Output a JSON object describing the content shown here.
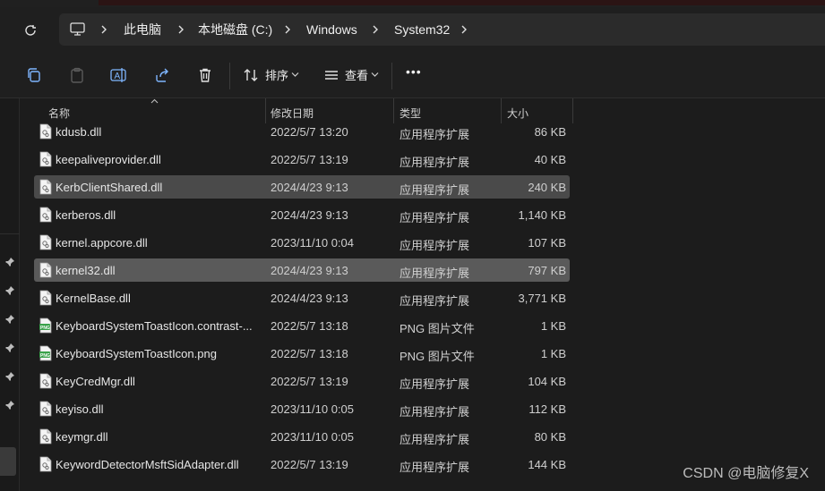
{
  "address": {
    "refresh_icon": "refresh-icon",
    "computer_icon": "computer-icon",
    "crumbs": [
      "此电脑",
      "本地磁盘 (C:)",
      "Windows",
      "System32"
    ]
  },
  "toolbar": {
    "sort_label": "排序",
    "view_label": "查看",
    "more_label": "•••"
  },
  "columns": {
    "name": "名称",
    "date": "修改日期",
    "type": "类型",
    "size": "大小"
  },
  "files": [
    {
      "name": "kdusb.dll",
      "date": "2022/5/7 13:20",
      "type": "应用程序扩展",
      "size": "86 KB",
      "icon": "dll"
    },
    {
      "name": "keepaliveprovider.dll",
      "date": "2022/5/7 13:19",
      "type": "应用程序扩展",
      "size": "40 KB",
      "icon": "dll"
    },
    {
      "name": "KerbClientShared.dll",
      "date": "2024/4/23 9:13",
      "type": "应用程序扩展",
      "size": "240 KB",
      "icon": "dll",
      "selected": true
    },
    {
      "name": "kerberos.dll",
      "date": "2024/4/23 9:13",
      "type": "应用程序扩展",
      "size": "1,140 KB",
      "icon": "dll"
    },
    {
      "name": "kernel.appcore.dll",
      "date": "2023/11/10 0:04",
      "type": "应用程序扩展",
      "size": "107 KB",
      "icon": "dll"
    },
    {
      "name": "kernel32.dll",
      "date": "2024/4/23 9:13",
      "type": "应用程序扩展",
      "size": "797 KB",
      "icon": "dll",
      "selected": true
    },
    {
      "name": "KernelBase.dll",
      "date": "2024/4/23 9:13",
      "type": "应用程序扩展",
      "size": "3,771 KB",
      "icon": "dll"
    },
    {
      "name": "KeyboardSystemToastIcon.contrast-...",
      "date": "2022/5/7 13:18",
      "type": "PNG 图片文件",
      "size": "1 KB",
      "icon": "png"
    },
    {
      "name": "KeyboardSystemToastIcon.png",
      "date": "2022/5/7 13:18",
      "type": "PNG 图片文件",
      "size": "1 KB",
      "icon": "png"
    },
    {
      "name": "KeyCredMgr.dll",
      "date": "2022/5/7 13:19",
      "type": "应用程序扩展",
      "size": "104 KB",
      "icon": "dll"
    },
    {
      "name": "keyiso.dll",
      "date": "2023/11/10 0:05",
      "type": "应用程序扩展",
      "size": "112 KB",
      "icon": "dll"
    },
    {
      "name": "keymgr.dll",
      "date": "2023/11/10 0:05",
      "type": "应用程序扩展",
      "size": "80 KB",
      "icon": "dll"
    },
    {
      "name": "KeywordDetectorMsftSidAdapter.dll",
      "date": "2022/5/7 13:19",
      "type": "应用程序扩展",
      "size": "144 KB",
      "icon": "dll"
    }
  ],
  "watermark": "CSDN @电脑修复X"
}
